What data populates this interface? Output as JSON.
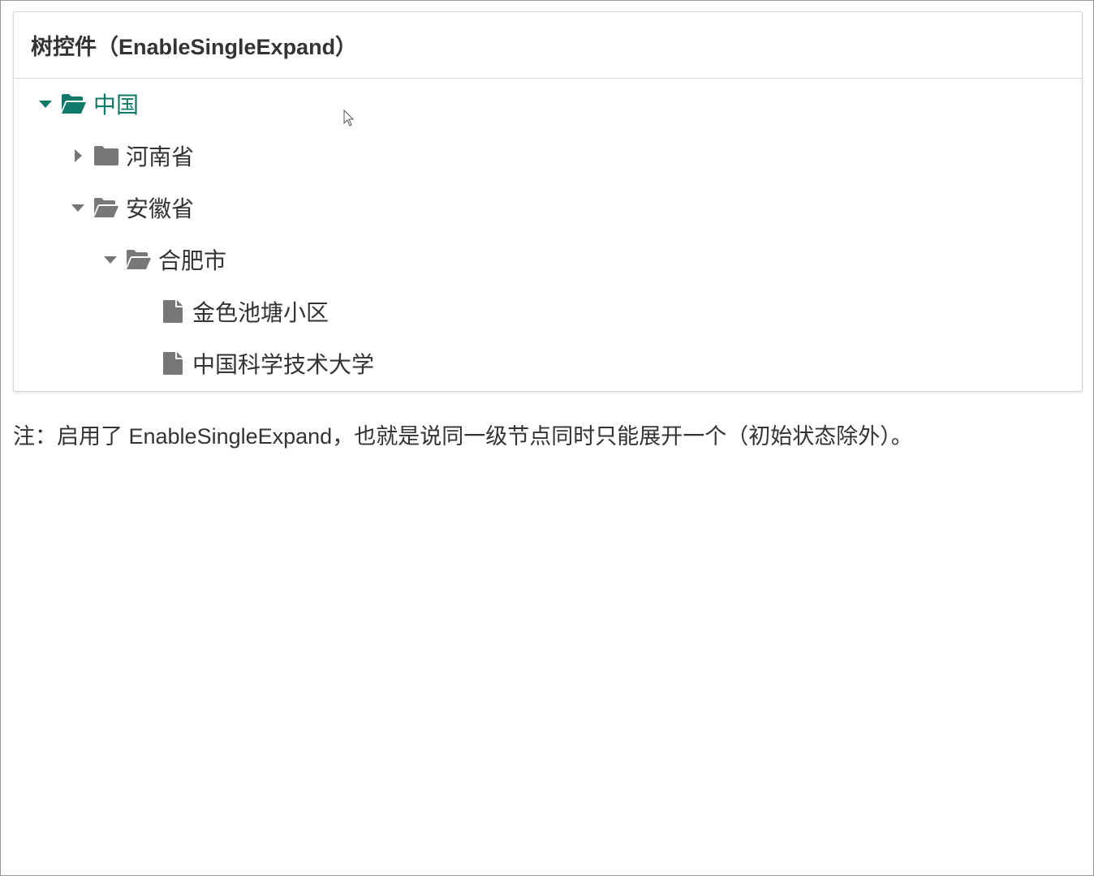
{
  "panel": {
    "title": "树控件（EnableSingleExpand）"
  },
  "tree": {
    "nodes": [
      {
        "label": "中国",
        "expanded": true,
        "level": 0,
        "type": "folder",
        "selected": true
      },
      {
        "label": "河南省",
        "expanded": false,
        "level": 1,
        "type": "folder",
        "selected": false
      },
      {
        "label": "安徽省",
        "expanded": true,
        "level": 1,
        "type": "folder",
        "selected": false
      },
      {
        "label": "合肥市",
        "expanded": true,
        "level": 2,
        "type": "folder",
        "selected": false
      },
      {
        "label": "金色池塘小区",
        "level": 3,
        "type": "leaf",
        "selected": false
      },
      {
        "label": "中国科学技术大学",
        "level": 3,
        "type": "leaf",
        "selected": false
      }
    ]
  },
  "note": {
    "text": "注：启用了 EnableSingleExpand，也就是说同一级节点同时只能展开一个（初始状态除外）。"
  },
  "colors": {
    "selected": "#0f7a6a",
    "icon_default": "#777777",
    "text": "#333333"
  },
  "icons": {
    "expanded": "caret-down-icon",
    "collapsed": "caret-right-icon",
    "folder_open": "folder-open-icon",
    "folder_closed": "folder-icon",
    "leaf": "file-icon"
  }
}
